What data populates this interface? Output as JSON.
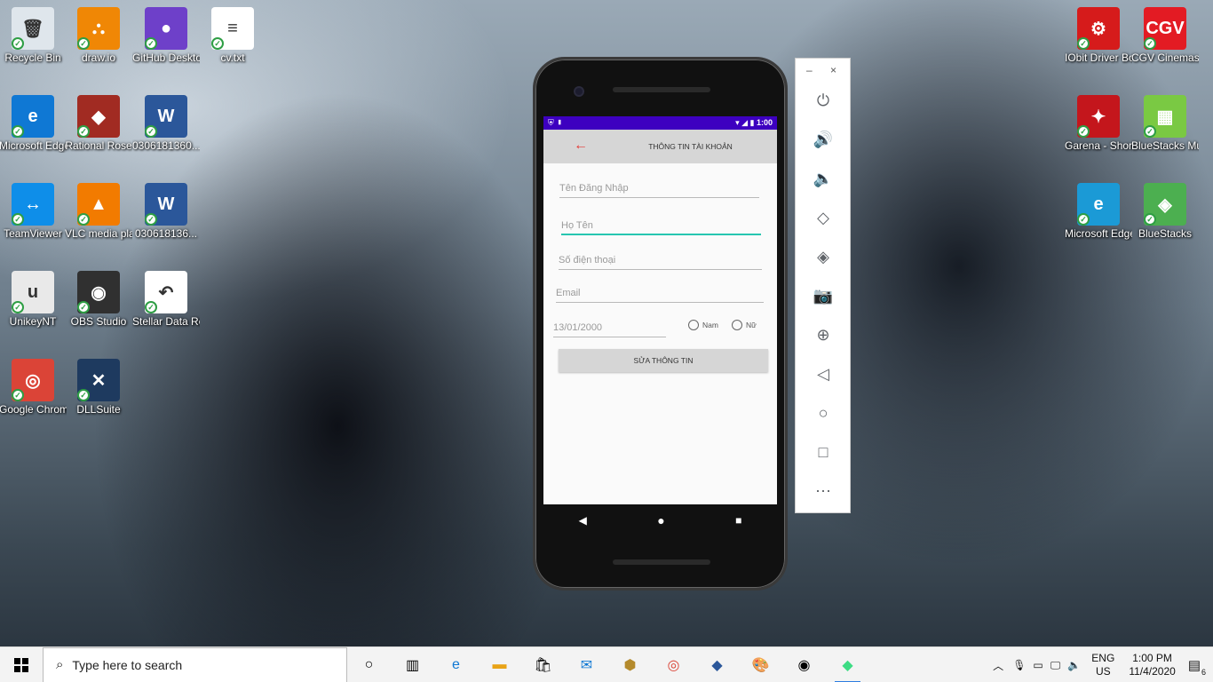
{
  "desktop": {
    "icons_left": [
      {
        "label": "Recycle Bin",
        "glyph": "🗑",
        "color": "#dfe6ec"
      },
      {
        "label": "draw.io",
        "glyph": "⛬",
        "color": "#f08705"
      },
      {
        "label": "GitHub Desktop",
        "glyph": "●",
        "color": "#6e40c9"
      },
      {
        "label": "cv.txt",
        "glyph": "≡",
        "color": "#ffffff"
      },
      {
        "label": "Microsoft Edge",
        "glyph": "e",
        "color": "#0f78d4"
      },
      {
        "label": "Rational Rose",
        "glyph": "◆",
        "color": "#a12b22"
      },
      {
        "label": "0306181360...",
        "glyph": "W",
        "color": "#2b579a"
      },
      {
        "label": "TeamViewer",
        "glyph": "↔",
        "color": "#0e8ee9"
      },
      {
        "label": "VLC media player",
        "glyph": "▲",
        "color": "#f27b00"
      },
      {
        "label": "030618136...",
        "glyph": "W",
        "color": "#2b579a"
      },
      {
        "label": "UnikeyNT",
        "glyph": "u",
        "color": "#e9e9e9"
      },
      {
        "label": "OBS Studio",
        "glyph": "◉",
        "color": "#303030"
      },
      {
        "label": "Stellar Data Recovery",
        "glyph": "↶",
        "color": "#ffffff"
      },
      {
        "label": "Google Chrome",
        "glyph": "◎",
        "color": "#db4437"
      },
      {
        "label": "DLLSuite",
        "glyph": "✕",
        "color": "#1e3a5f"
      }
    ],
    "icons_right": [
      {
        "label": "IObit Driver Booster",
        "glyph": "⚙",
        "color": "#d61b1b"
      },
      {
        "label": "CGV Cinemas",
        "glyph": "CGV",
        "color": "#e31b23"
      },
      {
        "label": "Garena - Shortcut",
        "glyph": "✦",
        "color": "#c4161c"
      },
      {
        "label": "BlueStacks Multi-Insta...",
        "glyph": "▦",
        "color": "#7ac943"
      },
      {
        "label": "Microsoft Edge",
        "glyph": "e",
        "color": "#1b9ad6"
      },
      {
        "label": "BlueStacks",
        "glyph": "◈",
        "color": "#4caf50"
      }
    ]
  },
  "phone": {
    "status_time": "1:00",
    "toolbar_title": "THÔNG TIN TÀI KHOẢN",
    "fields": {
      "username": "Tên Đăng Nhập",
      "fullname": "Họ Tên",
      "phone": "Số điện thoại",
      "email": "Email",
      "dob": "13/01/2000"
    },
    "gender": {
      "male": "Nam",
      "female": "Nữ"
    },
    "submit_label": "SỬA THÔNG TIN"
  },
  "emulator_panel": {
    "minimize": "–",
    "close": "×",
    "buttons": [
      "power-icon",
      "volume-up-icon",
      "volume-down-icon",
      "rotate-left-icon",
      "rotate-right-icon",
      "camera-icon",
      "zoom-icon",
      "back-icon",
      "home-icon",
      "overview-icon",
      "more-icon"
    ]
  },
  "taskbar": {
    "search_placeholder": "Type here to search",
    "lang_top": "ENG",
    "lang_bottom": "US",
    "time": "1:00 PM",
    "date": "11/4/2020",
    "notification_count": "6"
  }
}
